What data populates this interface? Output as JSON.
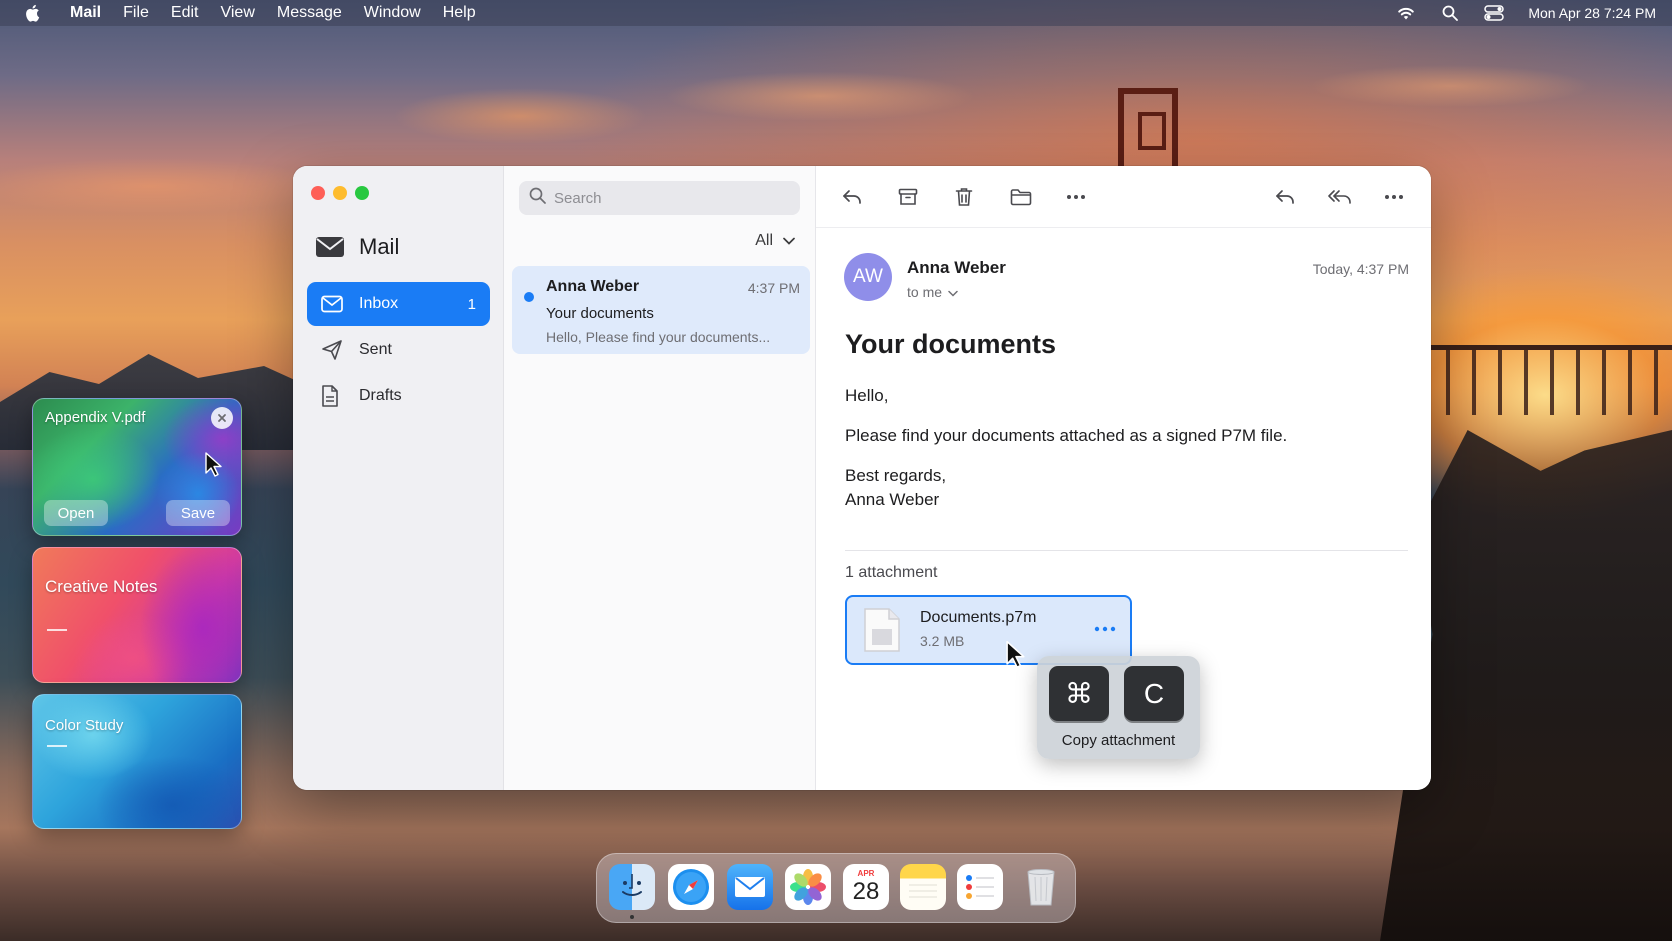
{
  "menubar": {
    "app": "Mail",
    "items": [
      "File",
      "Edit",
      "View",
      "Message",
      "Window",
      "Help"
    ],
    "clock": "Mon Apr 28  7:24 PM"
  },
  "sidebar": {
    "title": "Mail",
    "items": [
      {
        "label": "Inbox",
        "count": "1",
        "icon": "inbox-icon"
      },
      {
        "label": "Sent",
        "icon": "paper-plane-icon"
      },
      {
        "label": "Drafts",
        "icon": "document-icon"
      }
    ]
  },
  "list": {
    "search_placeholder": "Search",
    "filter": "All",
    "message": {
      "from": "Anna Weber",
      "time": "4:37 PM",
      "subject": "Your documents",
      "preview": "Hello, Please find your documents..."
    }
  },
  "reader": {
    "avatar": "AW",
    "sender": "Anna Weber",
    "to": "to me",
    "date": "Today, 4:37 PM",
    "subject": "Your documents",
    "body": {
      "greeting": "Hello,",
      "line1": "Please find your documents attached as a signed P7M file.",
      "signoff": "Best regards,",
      "name": "Anna Weber"
    },
    "attachment_count": "1 attachment",
    "attachment": {
      "name": "Documents.p7m",
      "size": "3.2 MB"
    }
  },
  "shortcut": {
    "key1": "⌘",
    "key2": "C",
    "label": "Copy attachment"
  },
  "widgets": [
    {
      "title": "Appendix V.pdf",
      "open": "Open",
      "save": "Save"
    },
    {
      "title": "Creative Notes"
    },
    {
      "title": "Color Study"
    }
  ],
  "dock": {
    "calendar_month": "APR",
    "calendar_day": "28",
    "apps": [
      "finder-icon",
      "safari-icon",
      "mail-icon",
      "photos-icon",
      "calendar-icon",
      "notes-icon",
      "reminders-icon",
      "trash-icon"
    ]
  },
  "colors": {
    "accent": "#1a7cf5",
    "avatar": "#8f8ee9"
  }
}
